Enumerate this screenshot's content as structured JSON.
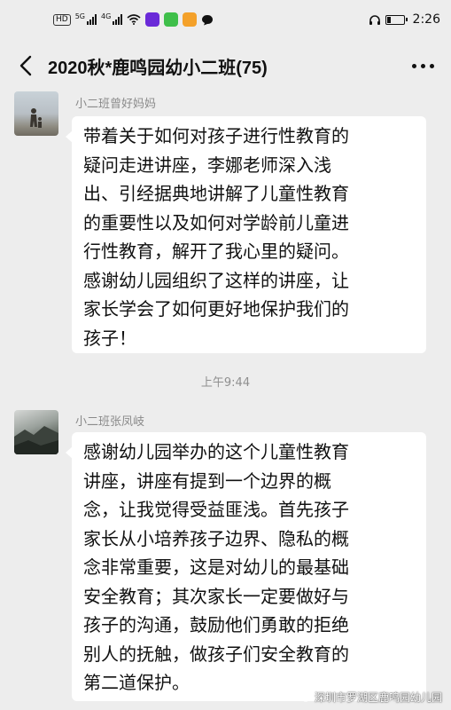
{
  "status_bar": {
    "hd_label": "HD",
    "net_label_1": "5G",
    "net_label_2": "4G",
    "battery_level": 0.25,
    "time": "2:26"
  },
  "header": {
    "back_icon": "chevron-left-icon",
    "title": "2020秋*鹿鸣园幼小二班(75)",
    "more_icon": "more-dots-icon"
  },
  "messages": [
    {
      "sender": "小二班曾好妈妈",
      "text": "带着关于如何对孩子进行性教育的\n疑问走进讲座，李娜老师深入浅\n出、引经据典地讲解了儿童性教育\n的重要性以及如何对学龄前儿童进\n行性教育，解开了我心里的疑问。\n感谢幼儿园组织了这样的讲座，让\n家长学会了如何更好地保护我们的\n孩子！"
    },
    {
      "sender": "小二班张凤岐",
      "text": "感谢幼儿园举办的这个儿童性教育\n讲座，讲座有提到一个边界的概\n念，让我觉得受益匪浅。首先孩子\n家长从小培养孩子边界、隐私的概\n念非常重要，这是对幼儿的最基础\n安全教育；其次家长一定要做好与\n孩子的沟通，鼓励他们勇敢的拒绝\n别人的抚触，做孩子们安全教育的\n第二道保护。"
    }
  ],
  "timestamp": "上午9:44",
  "watermark": "深圳市罗湖区鹿鸣园幼儿园",
  "colors": {
    "background": "#ededed",
    "bubble": "#ffffff",
    "meta_text": "#8a8a8a"
  }
}
